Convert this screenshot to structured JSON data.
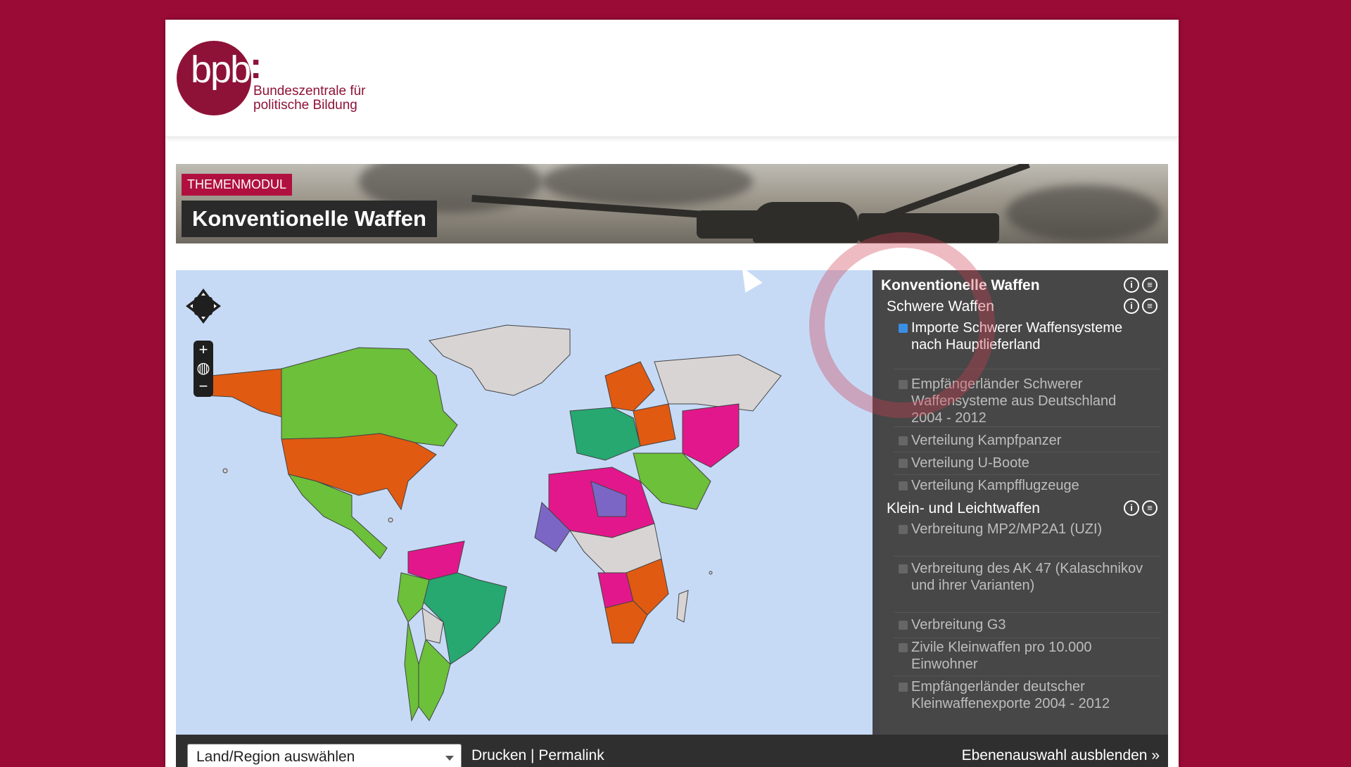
{
  "logo": {
    "brand": "bpb",
    "line1": "Bundeszentrale für",
    "line2": "politische Bildung"
  },
  "banner": {
    "tag": "THEMENMODUL",
    "title": "Konventionelle Waffen"
  },
  "map": {
    "country_colors": {
      "orange": "#e05a12",
      "green": "#6cc03a",
      "teal": "#26a870",
      "magenta": "#e3178c",
      "purple": "#7b66c6",
      "grey": "#d8d4d4",
      "ocean": "#c6daf6"
    },
    "zoom": {
      "plus": "+",
      "minus": "−"
    }
  },
  "panel": {
    "title": "Konventionelle Waffen",
    "groups": [
      {
        "label": "Schwere Waffen",
        "items": [
          {
            "label": "Importe Schwerer Waffensysteme nach Hauptlieferland",
            "checked": true
          },
          {
            "label": "Empfängerländer Schwerer Waffensysteme aus Deutschland 2004 - 2012",
            "checked": false
          },
          {
            "label": "Verteilung Kampfpanzer",
            "checked": false
          },
          {
            "label": "Verteilung U-Boote",
            "checked": false
          },
          {
            "label": "Verteilung Kampfflugzeuge",
            "checked": false
          }
        ]
      },
      {
        "label": "Klein- und Leichtwaffen",
        "items": [
          {
            "label": "Verbreitung MP2/MP2A1 (UZI)",
            "checked": false
          },
          {
            "label": "Verbreitung des AK 47 (Kalaschnikov und ihrer Varianten)",
            "checked": false
          },
          {
            "label": "Verbreitung G3",
            "checked": false
          },
          {
            "label": "Zivile Kleinwaffen pro 10.000 Einwohner",
            "checked": false
          },
          {
            "label": "Empfängerländer deutscher Kleinwaffenexporte 2004 - 2012",
            "checked": false
          }
        ]
      }
    ]
  },
  "footer": {
    "select_value": "Land/Region auswählen",
    "print": "Drucken",
    "separator": "|",
    "permalink": "Permalink",
    "hide_layers": "Ebenenauswahl ausblenden »"
  }
}
